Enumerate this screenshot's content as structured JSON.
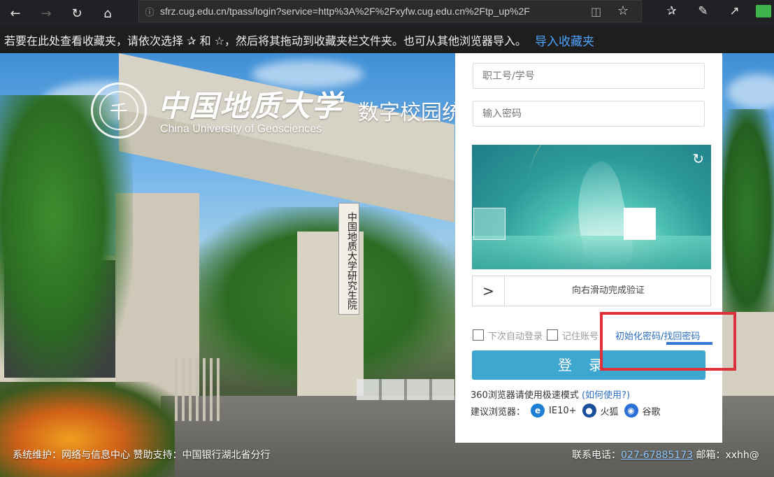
{
  "browser": {
    "url": "sfrz.cug.edu.cn/tpass/login?service=http%3A%2F%2Fxyfw.cug.edu.cn%2Ftp_up%2F",
    "icons": [
      "back-icon",
      "forward-icon",
      "refresh-icon",
      "home-icon",
      "info-icon",
      "reading-view-icon",
      "star-icon",
      "favorites-icon",
      "pen-icon",
      "share-icon"
    ]
  },
  "favbar": {
    "text": "若要在此处查看收藏夹，请依次选择 ✰ 和 ☆，然后将其拖动到收藏夹栏文件夹。也可从其他浏览器导入。",
    "import_link": "导入收藏夹"
  },
  "branding": {
    "logo_glyph": "千",
    "name_cn": "中国地质大学",
    "name_en": "China University of Geosciences",
    "system_title": "数字校园统",
    "gate_sign": "中国地质大学研究生院"
  },
  "login": {
    "username_placeholder": "职工号/学号",
    "password_placeholder": "输入密码",
    "slider_text": "向右滑动完成验证",
    "slider_handle": ">",
    "auto_login": "下次自动登录",
    "remember": "记住账号",
    "reset_link": "初始化密码/找回密码",
    "login_button": "登录",
    "tip_360": "360浏览器请使用极速模式",
    "tip_how": "(如何使用?)",
    "suggest_label": "建议浏览器：",
    "browsers": [
      {
        "icon": "ie-icon",
        "label": "IE10+"
      },
      {
        "icon": "firefox-icon",
        "label": "火狐"
      },
      {
        "icon": "chrome-icon",
        "label": "谷歌"
      }
    ]
  },
  "footer": {
    "left": "系统维护：网络与信息中心    赞助支持：中国银行湖北省分行",
    "contact_label": "联系电话：",
    "phone": "027-67885173",
    "email_label": "邮箱：xxhh@"
  },
  "colors": {
    "login_button": "#3ea7cf",
    "link": "#2b6cbf",
    "annotation": "#e0303a"
  }
}
